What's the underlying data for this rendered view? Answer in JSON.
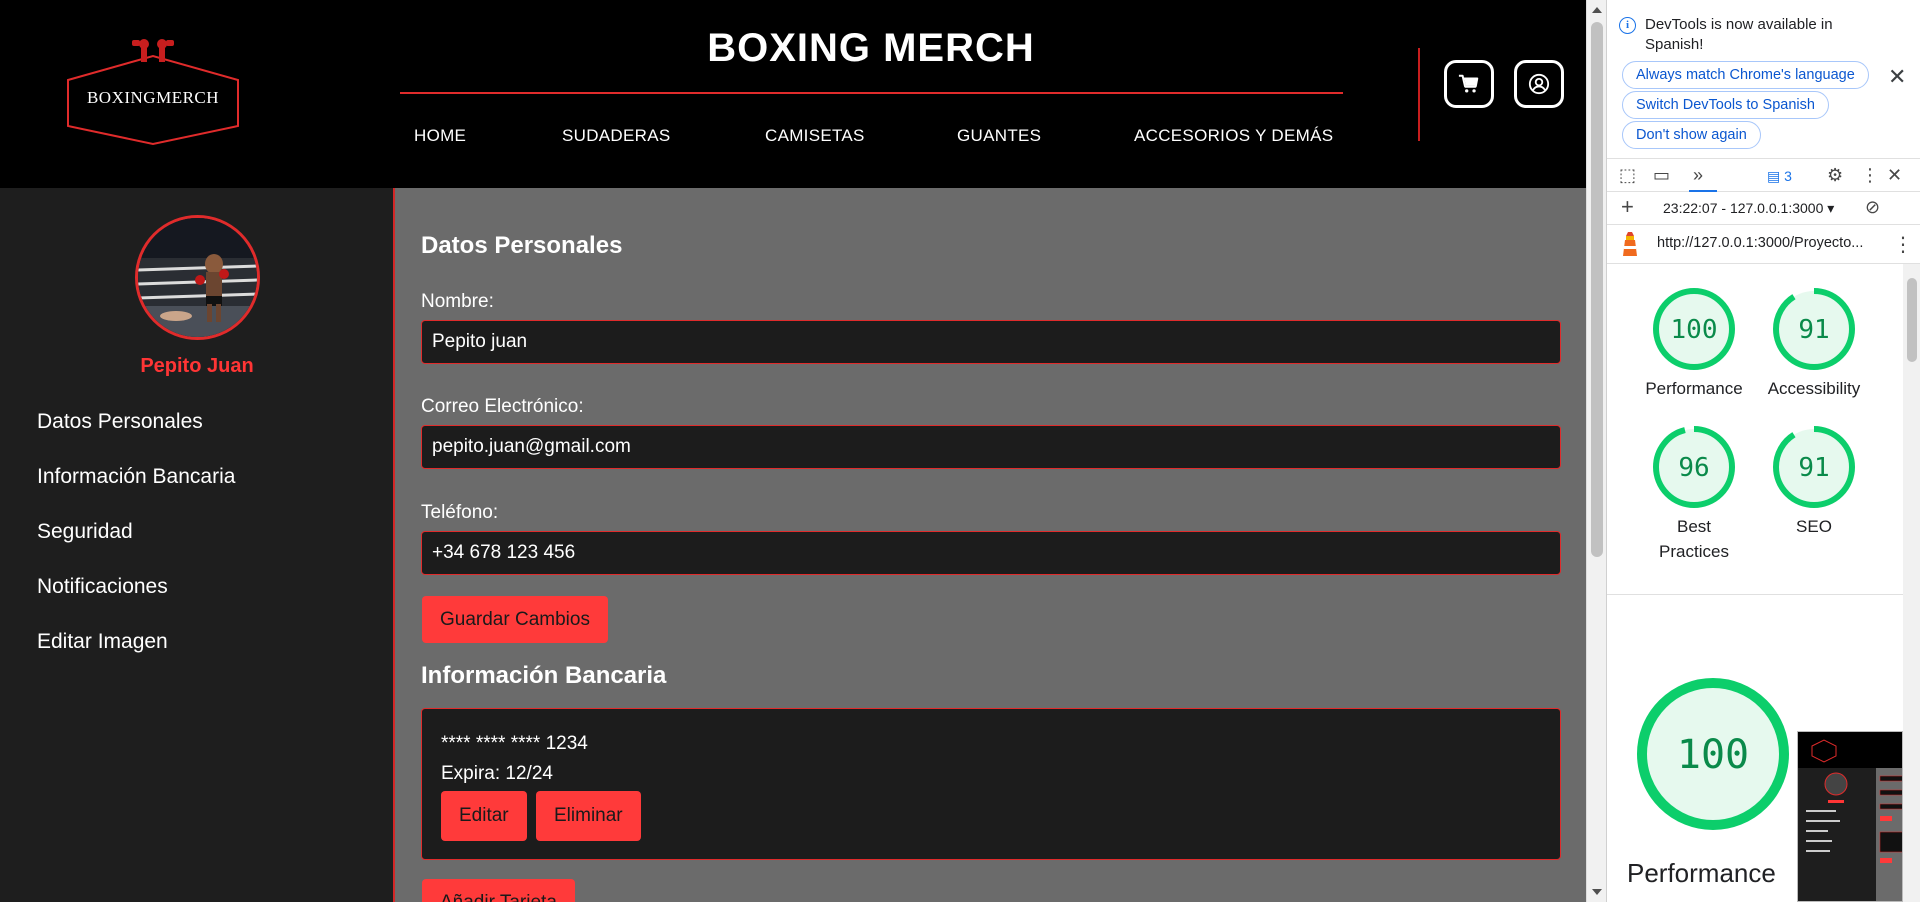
{
  "site": {
    "logo_text": "BOXINGMERCH",
    "title": "BOXING MERCH",
    "nav": [
      "HOME",
      "SUDADERAS",
      "CAMISETAS",
      "GUANTES",
      "ACCESORIOS Y DEMÁS"
    ],
    "cart_icon": "cart-icon",
    "user_icon": "user-circle-icon"
  },
  "profile": {
    "name": "Pepito Juan",
    "menu": [
      "Datos Personales",
      "Información Bancaria",
      "Seguridad",
      "Notificaciones",
      "Editar Imagen"
    ]
  },
  "personal": {
    "title": "Datos Personales",
    "name_label": "Nombre:",
    "name_value": "Pepito juan",
    "email_label": "Correo Electrónico:",
    "email_value": "pepito.juan@gmail.com",
    "phone_label": "Teléfono:",
    "phone_value": "+34 678 123 456",
    "save_label": "Guardar Cambios"
  },
  "banking": {
    "title": "Información Bancaria",
    "card_number": "**** **** **** 1234",
    "card_expiry": "Expira: 12/24",
    "edit_label": "Editar",
    "delete_label": "Eliminar",
    "add_label": "Añadir Tarjeta"
  },
  "colors": {
    "accent_red": "#ff3a3a",
    "header_bg": "#000000",
    "sidebar_bg": "#1e1e1e",
    "content_bg": "#6b6b6b",
    "score_green": "#0cce6b"
  },
  "devtools": {
    "notice": "DevTools is now available in Spanish!",
    "chip_match": "Always match Chrome's language",
    "chip_switch": "Switch DevTools to Spanish",
    "chip_dismiss": "Don't show again",
    "issues_count": "3",
    "report_select": "23:22:07 - 127.0.0.1:3000",
    "url": "http://127.0.0.1:3000/Proyecto...",
    "scores": [
      {
        "label": "Performance",
        "value": 100
      },
      {
        "label": "Accessibility",
        "value": 91
      },
      {
        "label": "Best Practices",
        "value": 96
      },
      {
        "label": "SEO",
        "value": 91
      }
    ],
    "big_score": {
      "label": "Performance",
      "value": 100
    }
  }
}
